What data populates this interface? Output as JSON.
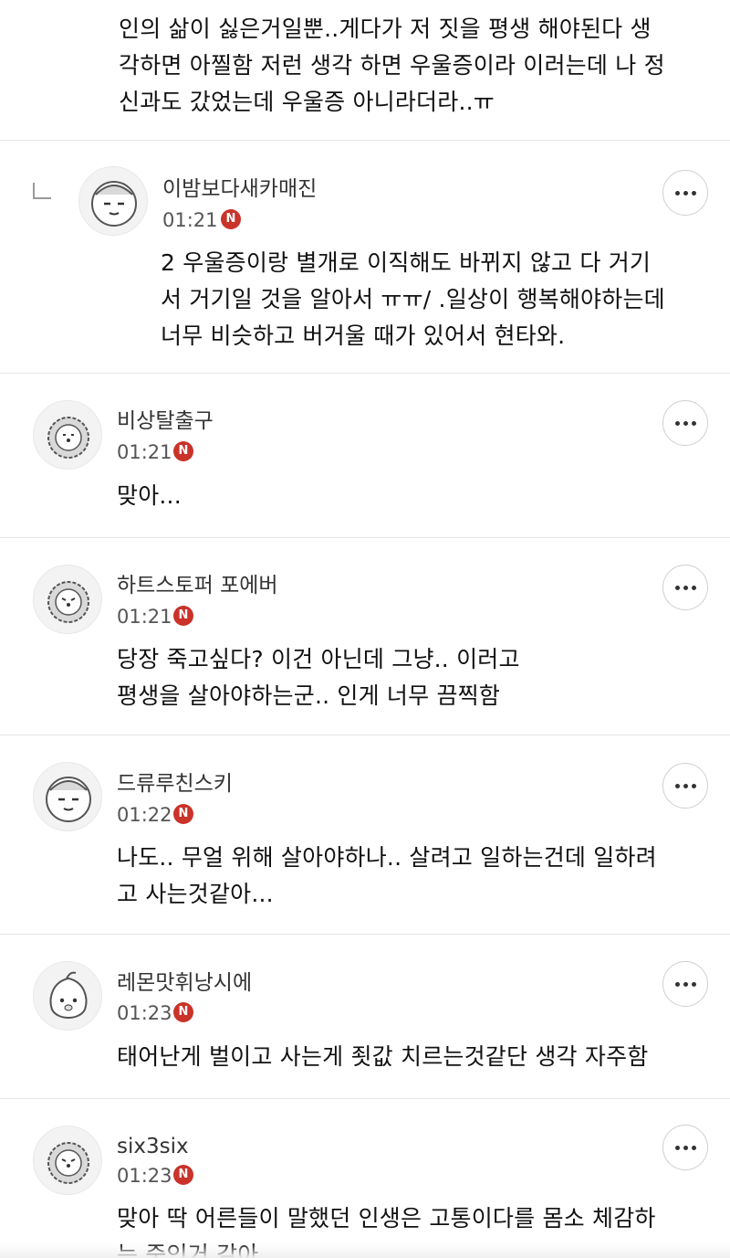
{
  "top_comment": {
    "text": "인의 삶이 싫은거일뿐..게다가 저 짓을 평생 해야된다 생\n각하면 아찔함 저런 생각 하면 우울증이라 이러는데 나 정\n신과도 갔었는데 우울증 아니라더라..ㅠ"
  },
  "comments": [
    {
      "nick": "이밤보다새카매진",
      "time": "01:21",
      "badge": "N",
      "avatar": "sleepy-cat-icon",
      "text": "2 우울증이랑 별개로 이직해도 바뀌지 않고 다 거기\n서 거기일 것을 알아서 ㅠㅠ/ .일상이 행복해야하는데\n너무 비슷하고 버거울 때가 있어서 현타와."
    },
    {
      "nick": "비상탈출구",
      "time": "01:21",
      "badge": "N",
      "avatar": "lion-icon",
      "text": "맞아..."
    },
    {
      "nick": "하트스토퍼 포에버",
      "time": "01:21",
      "badge": "N",
      "avatar": "lion-icon",
      "text": "당장 죽고싶다? 이건 아닌데 그냥.. 이러고\n평생을 살아야하는군.. 인게 너무 끔찍함"
    },
    {
      "nick": "드류루친스키",
      "time": "01:22",
      "badge": "N",
      "avatar": "sleepy-cat-icon",
      "text": "나도.. 무얼 위해 살아야하나.. 살려고 일하는건데 일하려\n고 사는것같아..."
    },
    {
      "nick": "레몬맛휘낭시에",
      "time": "01:23",
      "badge": "N",
      "avatar": "peach-icon",
      "text": "태어난게 벌이고 사는게 죗값 치르는것같단 생각 자주함"
    },
    {
      "nick": "six3six",
      "time": "01:23",
      "badge": "N",
      "avatar": "lion-icon",
      "text": "맞아 딱 어른들이 말했던 인생은 고통이다를 몸소 체감하\n는 중인거 같아"
    }
  ]
}
